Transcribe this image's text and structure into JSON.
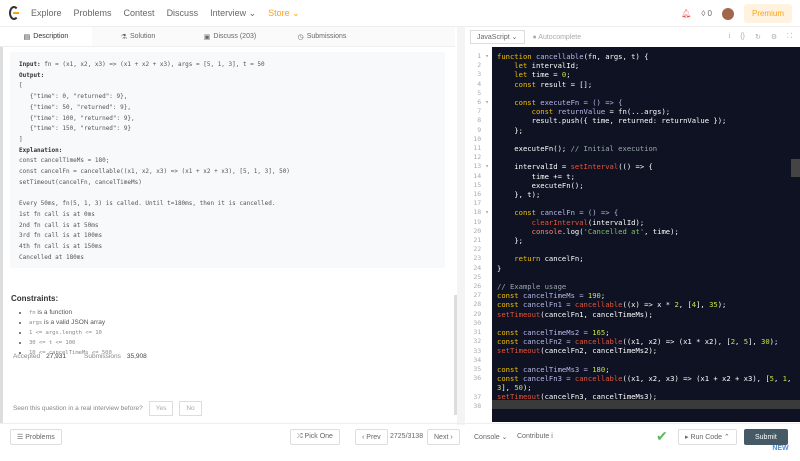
{
  "nav": {
    "items": [
      "Explore",
      "Problems",
      "Contest",
      "Discuss",
      "Interview ⌄",
      "Store ⌄"
    ],
    "points": "0",
    "premium": "Premium"
  },
  "tabs": [
    "Description",
    "Solution",
    "Discuss (203)",
    "Submissions"
  ],
  "example": {
    "input_label": "Input:",
    "input": " fn = (x1, x2, x3) => (x1 + x2 + x3), args = [5, 1, 3], t = 50",
    "output_label": "Output:",
    "output": "[\n   {\"time\": 0, \"returned\": 9},\n   {\"time\": 50, \"returned\": 9},\n   {\"time\": 100, \"returned\": 9},\n   {\"time\": 150, \"returned\": 9}\n]",
    "explanation_label": "Explanation:",
    "explanation": "const cancelTimeMs = 180;\nconst cancelFn = cancellable((x1, x2, x3) => (x1 + x2 + x3), [5, 1, 3], 50)\nsetTimeout(cancelFn, cancelTimeMs)\n\nEvery 50ms, fn(5, 1, 3) is called. Until t=180ms, then it is cancelled.\n1st fn call is at 0ms\n2nd fn call is at 50ms\n3rd fn call is at 100ms\n4th fn call is at 150ms\nCancelled at 180ms"
  },
  "constraints": {
    "title": "Constraints:",
    "items": [
      {
        "code": "fn",
        "text": " is a function"
      },
      {
        "code": "args",
        "text": " is a valid JSON array"
      },
      {
        "code": "1 <= args.length <= 10",
        "text": ""
      },
      {
        "code": "30 <= t <= 100",
        "text": ""
      },
      {
        "code": "10 <= cancelTimeMs <= 500",
        "text": ""
      }
    ]
  },
  "stats": {
    "accepted_label": "Accepted",
    "accepted": "27,931",
    "submissions_label": "Submissions",
    "submissions": "35,908"
  },
  "seen": {
    "question": "Seen this question in a real interview before?",
    "yes": "Yes",
    "no": "No"
  },
  "editor": {
    "language": "JavaScript",
    "autocomplete": "Autocomplete",
    "new_badge": "NEW",
    "lines": [
      [
        [
          "function ",
          "k"
        ],
        [
          "cancellable",
          "v"
        ],
        [
          "(fn, args, t) {",
          "p"
        ]
      ],
      [
        [
          "    let ",
          "k"
        ],
        [
          "intervalId;",
          "p"
        ]
      ],
      [
        [
          "    let ",
          "k"
        ],
        [
          "time = ",
          "p"
        ],
        [
          "0",
          "n"
        ],
        [
          ";",
          "p"
        ]
      ],
      [
        [
          "    const ",
          "k"
        ],
        [
          "result = [];",
          "p"
        ]
      ],
      [],
      [
        [
          "    const ",
          "k"
        ],
        [
          "executeFn = () => {",
          "v"
        ]
      ],
      [
        [
          "        const ",
          "k"
        ],
        [
          "returnValue",
          "v"
        ],
        [
          " = fn(...args);",
          "p"
        ]
      ],
      [
        [
          "        result.push({ time, returned: returnValue });",
          "p"
        ]
      ],
      [
        [
          "    };",
          "p"
        ]
      ],
      [],
      [
        [
          "    executeFn(); ",
          "p"
        ],
        [
          "// Initial execution",
          "c"
        ]
      ],
      [],
      [
        [
          "    intervalId = ",
          "p"
        ],
        [
          "setInterval",
          "f"
        ],
        [
          "(() => {",
          "p"
        ]
      ],
      [
        [
          "        time += t;",
          "p"
        ]
      ],
      [
        [
          "        executeFn();",
          "p"
        ]
      ],
      [
        [
          "    }, t);",
          "p"
        ]
      ],
      [],
      [
        [
          "    const ",
          "k"
        ],
        [
          "cancelFn = () => {",
          "v"
        ]
      ],
      [
        [
          "        ",
          "p"
        ],
        [
          "clearInterval",
          "f"
        ],
        [
          "(intervalId);",
          "p"
        ]
      ],
      [
        [
          "        ",
          "p"
        ],
        [
          "console",
          "o"
        ],
        [
          ".log(",
          "p"
        ],
        [
          "'Cancelled at'",
          "s"
        ],
        [
          ", time);",
          "p"
        ]
      ],
      [
        [
          "    };",
          "p"
        ]
      ],
      [],
      [
        [
          "    return ",
          "k"
        ],
        [
          "cancelFn;",
          "p"
        ]
      ],
      [
        [
          "}",
          "p"
        ]
      ],
      [],
      [
        [
          "// Example usage",
          "c"
        ]
      ],
      [
        [
          "const ",
          "k"
        ],
        [
          "cancelTimeMs = ",
          "v"
        ],
        [
          "190",
          "n"
        ],
        [
          ";",
          "p"
        ]
      ],
      [
        [
          "const ",
          "k"
        ],
        [
          "cancelFn1 = ",
          "v"
        ],
        [
          "cancellable",
          "f"
        ],
        [
          "((x) => x * ",
          "p"
        ],
        [
          "2",
          "n"
        ],
        [
          ", [",
          "p"
        ],
        [
          "4",
          "n"
        ],
        [
          "], ",
          "p"
        ],
        [
          "35",
          "n"
        ],
        [
          ");",
          "p"
        ]
      ],
      [
        [
          "setTimeout",
          "f"
        ],
        [
          "(cancelFn1, cancelTimeMs);",
          "p"
        ]
      ],
      [],
      [
        [
          "const ",
          "k"
        ],
        [
          "cancelTimeMs2 = ",
          "v"
        ],
        [
          "165",
          "n"
        ],
        [
          ";",
          "p"
        ]
      ],
      [
        [
          "const ",
          "k"
        ],
        [
          "cancelFn2 = ",
          "v"
        ],
        [
          "cancellable",
          "f"
        ],
        [
          "((x1, x2) => (x1 * x2), [",
          "p"
        ],
        [
          "2",
          "n"
        ],
        [
          ", ",
          "p"
        ],
        [
          "5",
          "n"
        ],
        [
          "], ",
          "p"
        ],
        [
          "30",
          "n"
        ],
        [
          ");",
          "p"
        ]
      ],
      [
        [
          "setTimeout",
          "f"
        ],
        [
          "(cancelFn2, cancelTimeMs2);",
          "p"
        ]
      ],
      [],
      [
        [
          "const ",
          "k"
        ],
        [
          "cancelTimeMs3 = ",
          "v"
        ],
        [
          "180",
          "n"
        ],
        [
          ";",
          "p"
        ]
      ],
      [
        [
          "const ",
          "k"
        ],
        [
          "cancelFn3 = ",
          "v"
        ],
        [
          "cancellable",
          "f"
        ],
        [
          "((x1, x2, x3) => (x1 + x2 + x3), [",
          "p"
        ],
        [
          "5",
          "n"
        ],
        [
          ", ",
          "p"
        ],
        [
          "1",
          "n"
        ],
        [
          ",\n",
          "p"
        ],
        [
          "3",
          "n"
        ],
        [
          "], ",
          "p"
        ],
        [
          "50",
          "n"
        ],
        [
          ");",
          "p"
        ]
      ],
      [
        [
          "setTimeout",
          "f"
        ],
        [
          "(cancelFn3, cancelTimeMs3);",
          "p"
        ]
      ],
      []
    ]
  },
  "bottom": {
    "problems": "☰ Problems",
    "pick": "⤮ Pick One",
    "prev": "‹ Prev",
    "page": "2725/3138",
    "next": "Next ›",
    "console": "Console ⌄",
    "contribute": "Contribute i",
    "run": "▸ Run Code ⌃",
    "submit": "Submit"
  }
}
